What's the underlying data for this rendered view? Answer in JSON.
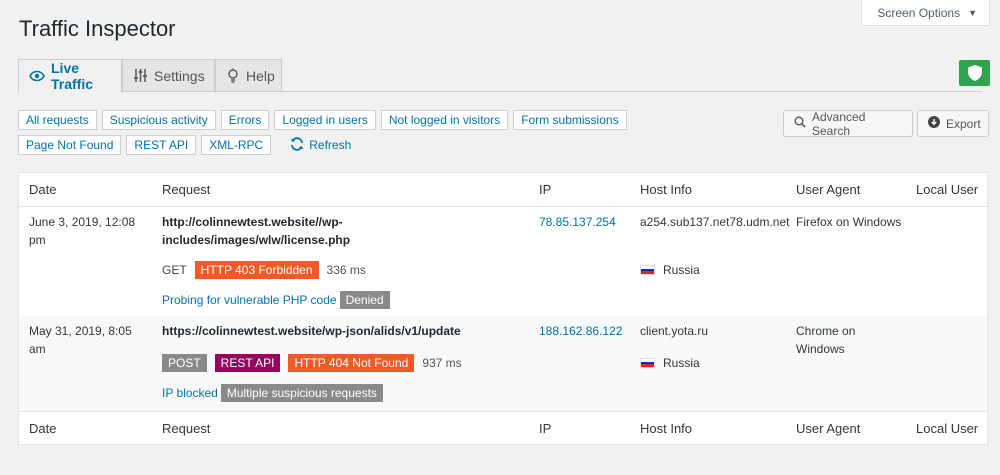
{
  "screen_options": {
    "label": "Screen Options"
  },
  "page_title": "Traffic Inspector",
  "tabs": [
    {
      "label": "Live Traffic",
      "icon": "eye-icon",
      "active": true
    },
    {
      "label": "Settings",
      "icon": "sliders-icon",
      "active": false
    },
    {
      "label": "Help",
      "icon": "lightbulb-icon",
      "active": false
    }
  ],
  "filters": {
    "row1": [
      "All requests",
      "Suspicious activity",
      "Errors",
      "Logged in users",
      "Not logged in visitors",
      "Form submissions"
    ],
    "row2": [
      "Page Not Found",
      "REST API",
      "XML-RPC"
    ],
    "refresh": "Refresh"
  },
  "buttons": {
    "advanced_search": "Advanced Search",
    "export": "Export"
  },
  "table": {
    "columns": [
      "Date",
      "Request",
      "IP",
      "Host Info",
      "User Agent",
      "Local User"
    ],
    "rows": [
      {
        "date": "June 3, 2019, 12:08 pm",
        "url": "http://colinnewtest.website//wp-includes/images/wlw/license.php",
        "method": "GET",
        "tags": [
          "HTTP 403 Forbidden"
        ],
        "time": "336 ms",
        "action": "Probing for vulnerable PHP code",
        "action_status": "Denied",
        "ip": "78.85.137.254",
        "host": "a254.sub137.net78.udm.net",
        "country": "Russia",
        "user_agent": "Firefox on Windows",
        "local_user": ""
      },
      {
        "date": "May 31, 2019, 8:05 am",
        "url": "https://colinnewtest.website/wp-json/alids/v1/update",
        "method": "POST",
        "tags": [
          "REST API",
          "HTTP 404 Not Found"
        ],
        "time": "937 ms",
        "action": "IP blocked",
        "action_status": "Multiple suspicious requests",
        "ip": "188.162.86.122",
        "host": "client.yota.ru",
        "country": "Russia",
        "user_agent": "Chrome on Windows",
        "local_user": ""
      }
    ]
  },
  "colors": {
    "accent": "#0073aa",
    "error": "#f05a28",
    "rest": "#96065e",
    "muted": "#8a8a8a",
    "shield": "#2ea44f"
  }
}
